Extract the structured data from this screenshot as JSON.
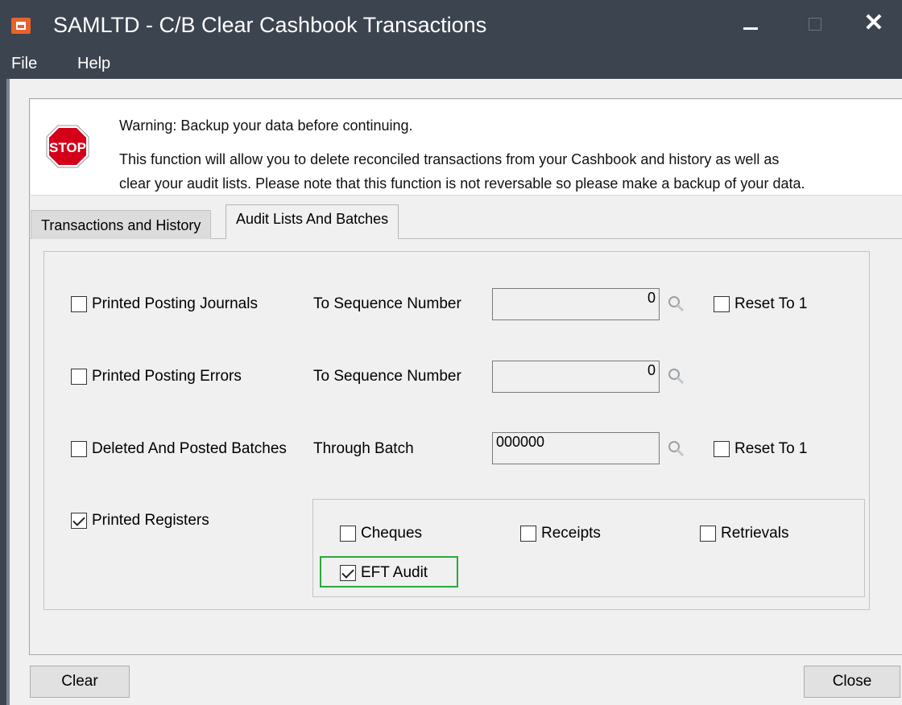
{
  "window": {
    "title": "SAMLTD - C/B Clear Cashbook Transactions",
    "minimize_glyph": "—",
    "maximize_glyph": "☐",
    "close_glyph": "✕"
  },
  "menu": {
    "items": [
      "File",
      "Help"
    ]
  },
  "warning": {
    "stop_label": "STOP",
    "line1": "Warning:   Backup your data before continuing.",
    "line2": "This function will allow you to delete reconciled transactions from your Cashbook and history as well as",
    "line3": "clear your audit lists. Please note that this function is not reversable so please make a backup of your data."
  },
  "tabs": [
    {
      "label": "Transactions and History",
      "active": false
    },
    {
      "label": "Audit Lists And Batches",
      "active": true
    }
  ],
  "rows": {
    "journals": {
      "label": "Printed Posting Journals",
      "checked": false,
      "field_label": "To Sequence Number",
      "value": "0",
      "reset_label": "Reset To 1",
      "reset_checked": false
    },
    "errors": {
      "label": "Printed Posting Errors",
      "checked": false,
      "field_label": "To Sequence Number",
      "value": "0"
    },
    "batches": {
      "label": "Deleted And Posted Batches",
      "checked": false,
      "field_label": "Through Batch",
      "value": "000000",
      "reset_label": "Reset To 1",
      "reset_checked": false
    },
    "registers": {
      "label": "Printed Registers",
      "checked": true
    }
  },
  "registers": {
    "cheques": {
      "label": "Cheques",
      "checked": false
    },
    "receipts": {
      "label": "Receipts",
      "checked": false
    },
    "retrievals": {
      "label": "Retrievals",
      "checked": false
    },
    "eft_audit": {
      "label": "EFT Audit",
      "checked": true
    }
  },
  "buttons": {
    "clear": "Clear",
    "close": "Close"
  },
  "colors": {
    "titlebar": "#3c4450",
    "highlight": "#2aa83c",
    "stop": "#d4001a"
  }
}
